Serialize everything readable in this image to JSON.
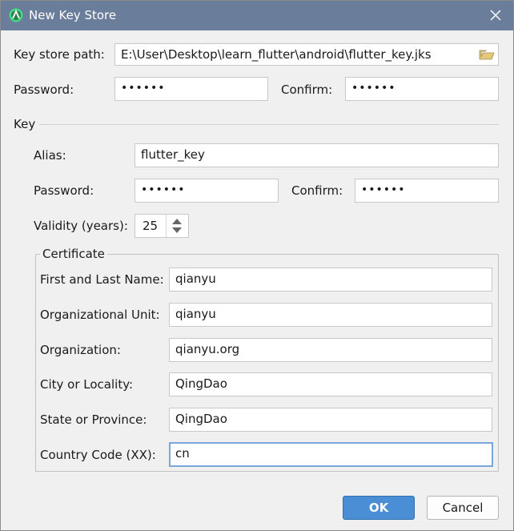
{
  "window": {
    "title": "New Key Store"
  },
  "keystore": {
    "path_label": "Key store path:",
    "path_value": "E:\\User\\Desktop\\learn_flutter\\android\\flutter_key.jks",
    "password_label": "Password:",
    "password_value": "••••••",
    "confirm_label": "Confirm:",
    "confirm_value": "••••••"
  },
  "key": {
    "section_label": "Key",
    "alias_label": "Alias:",
    "alias_value": "flutter_key",
    "password_label": "Password:",
    "password_value": "••••••",
    "confirm_label": "Confirm:",
    "confirm_value": "••••••",
    "validity_label": "Validity (years):",
    "validity_value": "25"
  },
  "certificate": {
    "title": "Certificate",
    "fields": [
      {
        "label": "First and Last Name:",
        "value": "qianyu"
      },
      {
        "label": "Organizational Unit:",
        "value": "qianyu"
      },
      {
        "label": "Organization:",
        "value": "qianyu.org"
      },
      {
        "label": "City or Locality:",
        "value": "QingDao"
      },
      {
        "label": "State or Province:",
        "value": "QingDao"
      },
      {
        "label": "Country Code (XX):",
        "value": "cn"
      }
    ]
  },
  "buttons": {
    "ok": "OK",
    "cancel": "Cancel"
  },
  "colors": {
    "titlebar": "#6a7d9a",
    "primary_button": "#4a8fd6",
    "focus_border": "#7aa7db"
  },
  "icons": {
    "app": "android-studio-icon",
    "close": "close-icon",
    "browse": "folder-icon",
    "spinner_up": "chevron-up-icon",
    "spinner_down": "chevron-down-icon"
  }
}
